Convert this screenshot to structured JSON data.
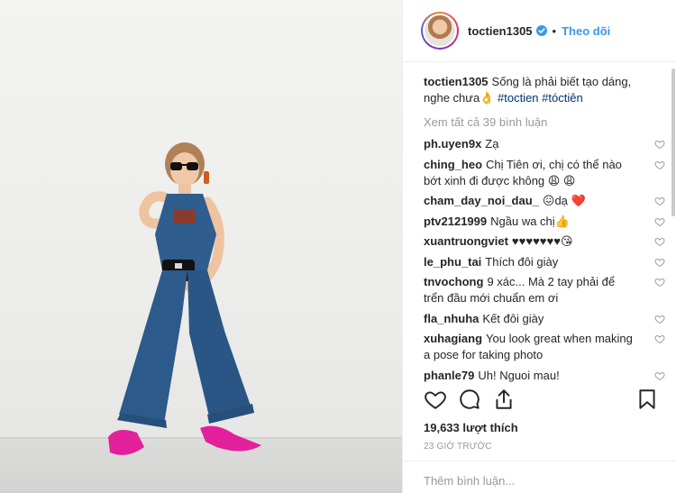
{
  "post": {
    "username": "toctien1305",
    "follow_label": "Theo dõi",
    "separator": "•"
  },
  "caption": {
    "username": "toctien1305",
    "text": "Sống là phải biết tạo dáng, nghe chưa👌 ",
    "hashtags": [
      "#toctien",
      "#tóctiên"
    ]
  },
  "view_all": "Xem tất cả 39 bình luận",
  "comments": [
    {
      "user": "ph.uyen9x",
      "text": "Zạ"
    },
    {
      "user": "ching_heo",
      "text": "Chị Tiên ơi, chị có thể nào bớt xinh đi được không 😩 😩"
    },
    {
      "user": "cham_day_noi_dau_",
      "text": "😖dạ ❤️"
    },
    {
      "user": "ptv2121999",
      "text": "Ngầu wa chị👍"
    },
    {
      "user": "xuantruongviet",
      "text": "♥♥♥♥♥♥♥😘"
    },
    {
      "user": "le_phu_tai",
      "text": "Thích đôi giày"
    },
    {
      "user": "tnvochong",
      "text": "9 xác... Mà 2 tay phải để trển đầu mới chuẩn em ơi"
    },
    {
      "user": "fla_nhuha",
      "text": "Kết đôi giày"
    },
    {
      "user": "xuhagiang",
      "text": "You look great when making a pose for taking photo"
    },
    {
      "user": "phanle79",
      "text": "Uh! Nguoi mau!"
    }
  ],
  "likes": "19,633 lượt thích",
  "timestamp": "23 GIỜ TRƯỚC",
  "add_comment_placeholder": "Thêm bình luận...",
  "icons": {
    "verified": "verified-badge-icon",
    "like": "heart-icon",
    "comment": "comment-icon",
    "share": "share-icon",
    "save": "bookmark-icon"
  },
  "colors": {
    "link_blue": "#3897f0",
    "hashtag": "#003569",
    "muted": "#999999",
    "text": "#262626",
    "border": "#efefef"
  }
}
